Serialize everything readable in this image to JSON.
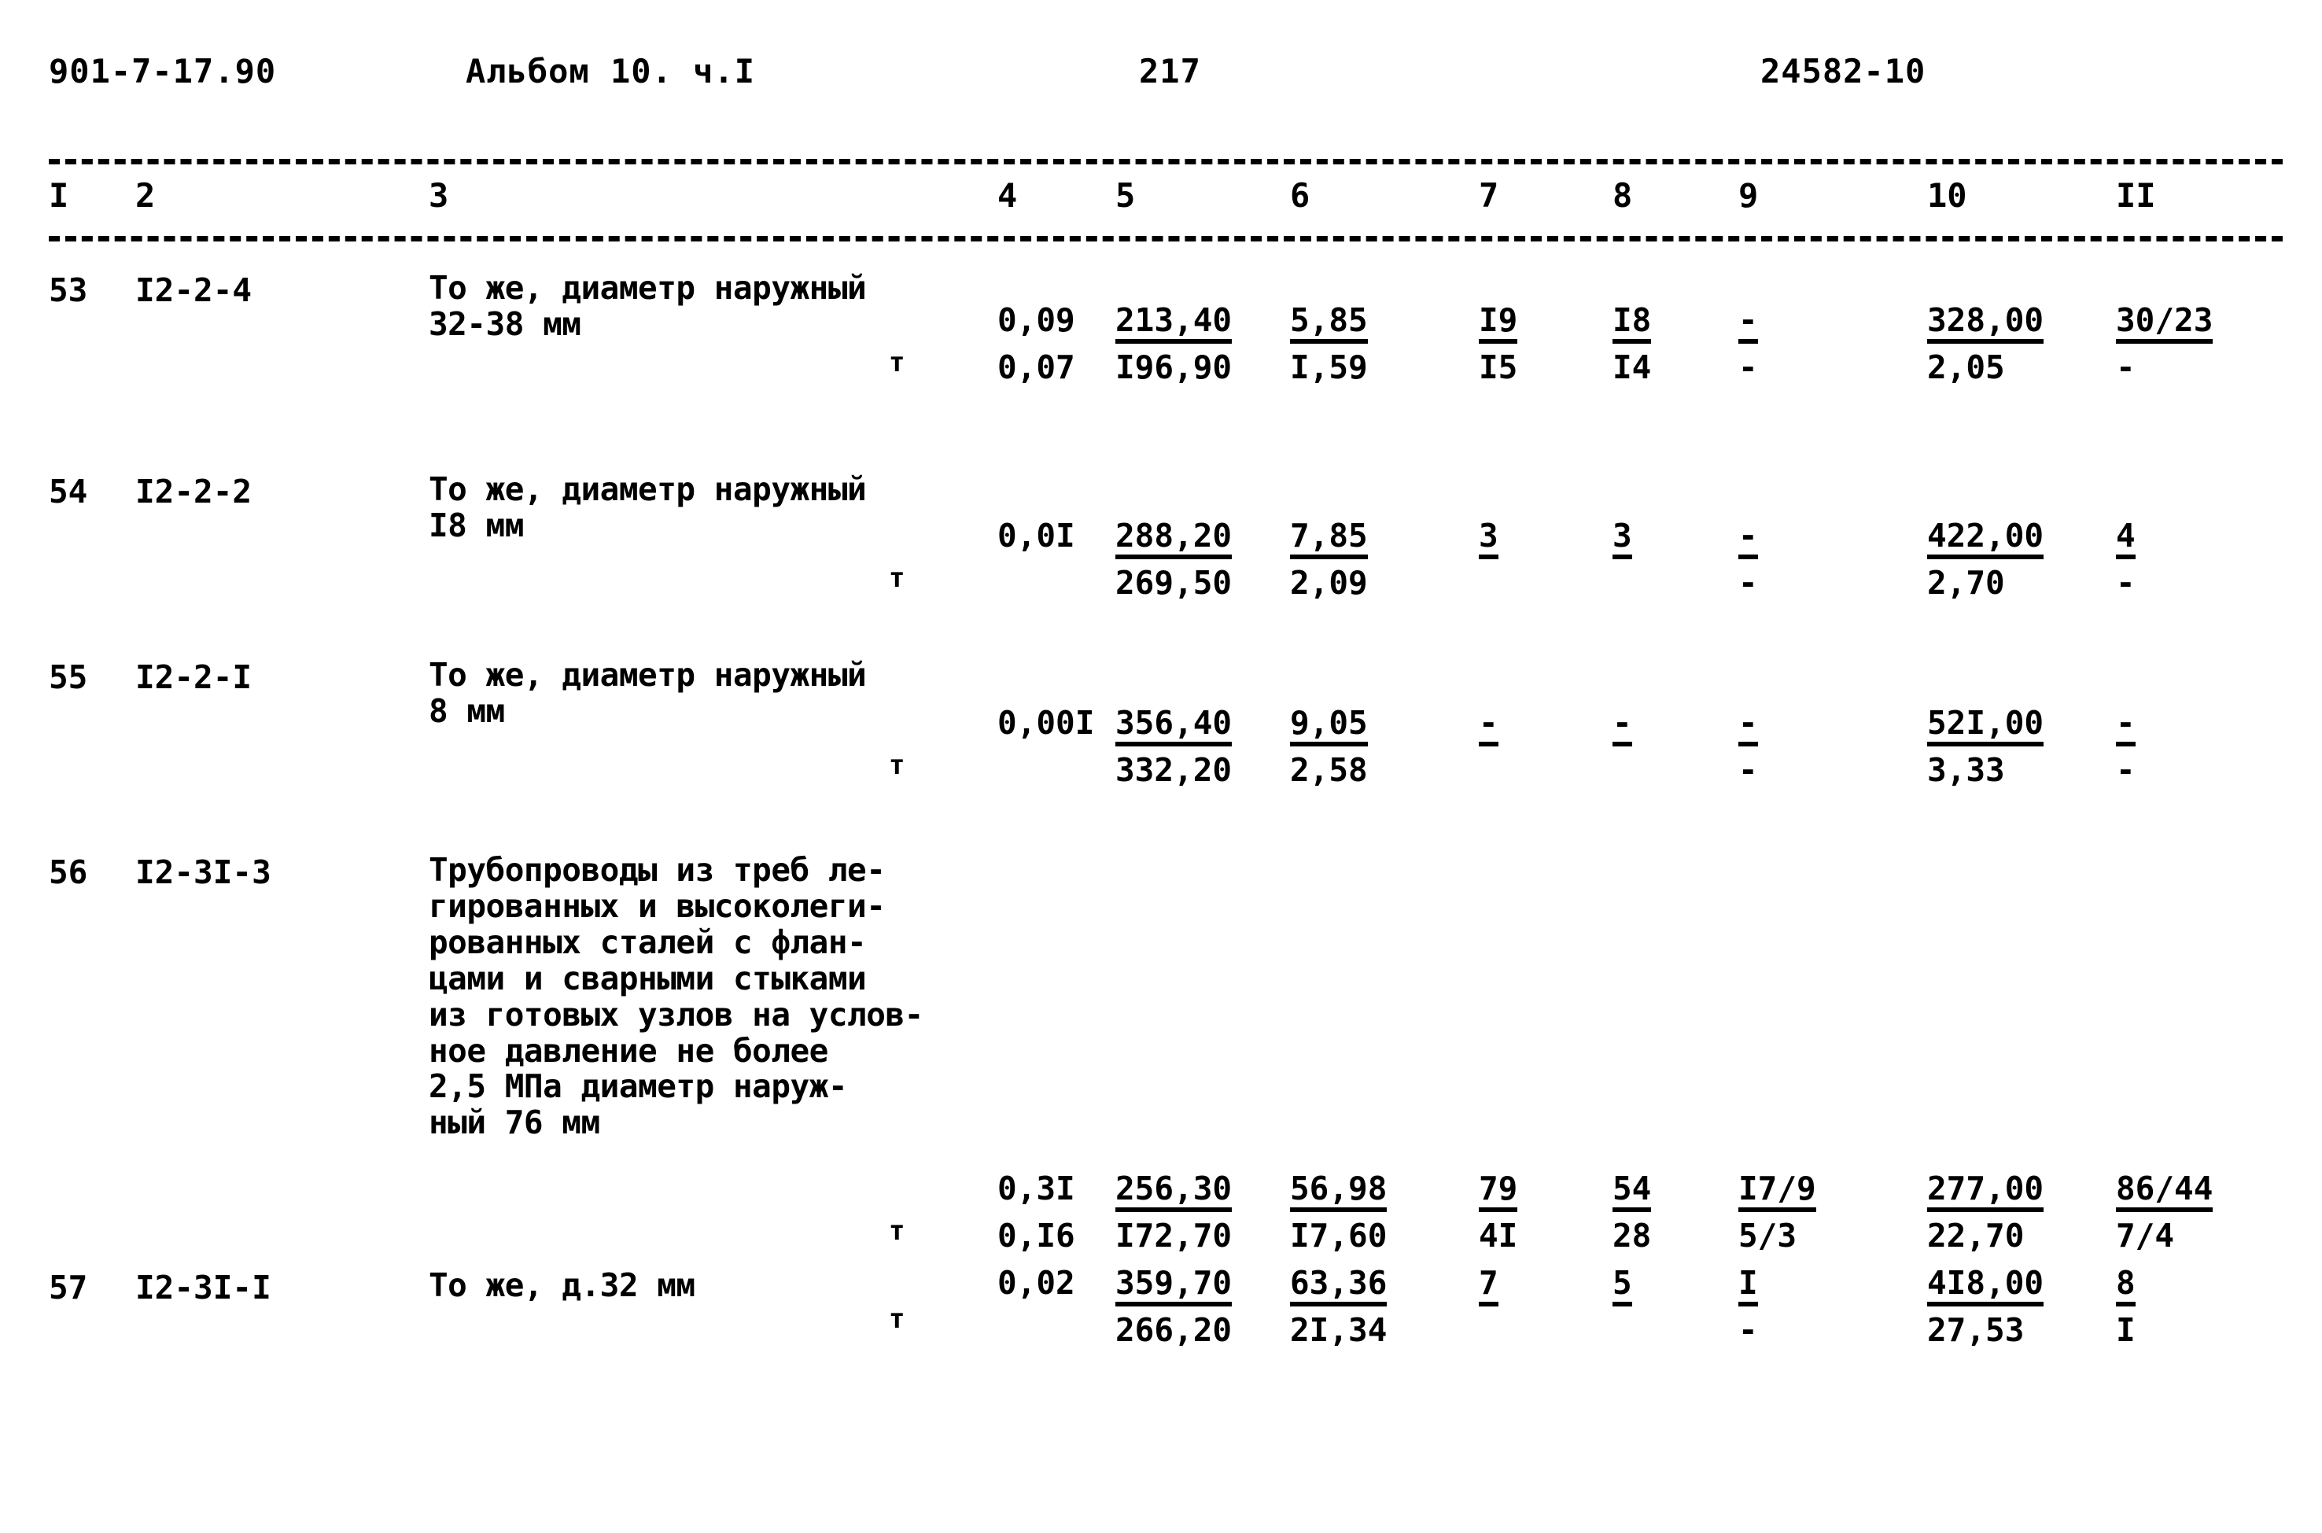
{
  "header": {
    "doc_code": "901-7-17.90",
    "album": "Альбом 10. ч.I",
    "page_number": "217",
    "right_code": "24582-10"
  },
  "table": {
    "column_headers": [
      "I",
      "2",
      "3",
      "4",
      "5",
      "6",
      "7",
      "8",
      "9",
      "10",
      "II"
    ],
    "unit_symbol": "т",
    "rows": [
      {
        "no": "53",
        "code": "I2-2-4",
        "description": "То же, диаметр наружный\n32-38 мм",
        "upper": {
          "c4": "0,09",
          "c5": "213,40",
          "c6": "5,85",
          "c7": "I9",
          "c8": "I8",
          "c9": "-",
          "c10": "328,00",
          "c11": "30/23"
        },
        "lower": {
          "c4": "0,07",
          "c5": "I96,90",
          "c6": "I,59",
          "c7": "I5",
          "c8": "I4",
          "c9": "-",
          "c10": "2,05",
          "c11": "-"
        }
      },
      {
        "no": "54",
        "code": "I2-2-2",
        "description": "То же, диаметр наружный\nI8 мм",
        "upper": {
          "c4": "0,0I",
          "c5": "288,20",
          "c6": "7,85",
          "c7": "3",
          "c8": "3",
          "c9": "-",
          "c10": "422,00",
          "c11": "4"
        },
        "lower": {
          "c4": "",
          "c5": "269,50",
          "c6": "2,09",
          "c7": "",
          "c8": "",
          "c9": "-",
          "c10": "2,70",
          "c11": "-"
        }
      },
      {
        "no": "55",
        "code": "I2-2-I",
        "description": "То же, диаметр наружный\n8 мм",
        "upper": {
          "c4": "0,00I",
          "c5": "356,40",
          "c6": "9,05",
          "c7": "-",
          "c8": "-",
          "c9": "-",
          "c10": "52I,00",
          "c11": "-"
        },
        "lower": {
          "c4": "",
          "c5": "332,20",
          "c6": "2,58",
          "c7": "",
          "c8": "",
          "c9": "-",
          "c10": "3,33",
          "c11": "-"
        }
      },
      {
        "no": "56",
        "code": "I2-3I-3",
        "description": "Трубопроводы из треб ле-\nгированных и высоколеги-\nрованных сталей с флан-\nцами и сварными стыками\nиз готовых узлов на услов-\nное давление не более\n2,5 МПа диаметр наруж-\nный 76 мм",
        "upper": {
          "c4": "0,3I",
          "c5": "256,30",
          "c6": "56,98",
          "c7": "79",
          "c8": "54",
          "c9": "I7/9",
          "c10": "277,00",
          "c11": "86/44"
        },
        "lower": {
          "c4": "0,I6",
          "c5": "I72,70",
          "c6": "I7,60",
          "c7": "4I",
          "c8": "28",
          "c9": "5/3",
          "c10": "22,70",
          "c11": "7/4"
        }
      },
      {
        "no": "57",
        "code": "I2-3I-I",
        "description": "То же, д.32 мм",
        "upper": {
          "c4": "0,02",
          "c5": "359,70",
          "c6": "63,36",
          "c7": "7",
          "c8": "5",
          "c9": "I",
          "c10": "4I8,00",
          "c11": "8"
        },
        "lower": {
          "c4": "",
          "c5": "266,20",
          "c6": "2I,34",
          "c7": "",
          "c8": "",
          "c9": "-",
          "c10": "27,53",
          "c11": "I"
        }
      }
    ]
  }
}
